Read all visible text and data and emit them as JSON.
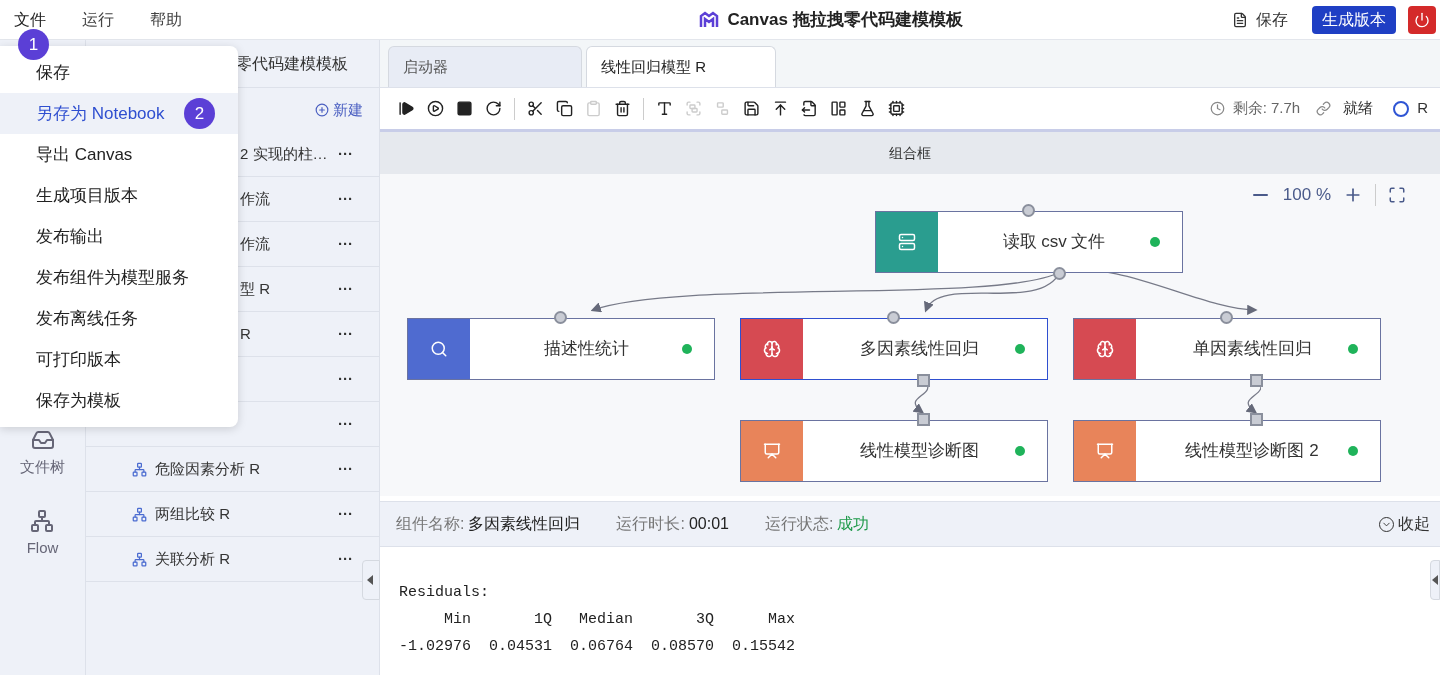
{
  "menubar": [
    {
      "label": "文件",
      "selected": true
    },
    {
      "label": "运行",
      "selected": false
    },
    {
      "label": "帮助",
      "selected": false
    }
  ],
  "app_title": "Canvas 拖拉拽零代码建模模板",
  "header_actions": {
    "save": "保存",
    "publish": "生成版本"
  },
  "file_menu": {
    "badge": "1",
    "items": [
      {
        "label": "保存",
        "selected": false
      },
      {
        "label": "另存为 Notebook",
        "selected": true,
        "badge": "2"
      },
      {
        "label": "导出 Canvas",
        "selected": false
      },
      {
        "label": "生成项目版本",
        "selected": false
      },
      {
        "label": "发布输出",
        "selected": false
      },
      {
        "label": "发布组件为模型服务",
        "selected": false
      },
      {
        "label": "发布离线任务",
        "selected": false
      },
      {
        "label": "可打印版本",
        "selected": false
      },
      {
        "label": "保存为模板",
        "selected": false
      }
    ]
  },
  "rail": [
    {
      "label": "文件树"
    },
    {
      "label": "Flow"
    }
  ],
  "sidebar": {
    "title": "零代码建模模板",
    "new_button": "新建",
    "items": [
      {
        "kind": "partial",
        "text": "2 实现的柱…",
        "more": "···"
      },
      {
        "kind": "partial",
        "text": "作流",
        "more": "···"
      },
      {
        "kind": "partial",
        "text": "作流",
        "more": "···"
      },
      {
        "kind": "partial",
        "text": "型 R",
        "more": "···"
      },
      {
        "kind": "partial",
        "text": "R",
        "more": "···"
      },
      {
        "kind": "hidden",
        "more": "···"
      },
      {
        "kind": "hidden",
        "more": "···"
      },
      {
        "kind": "full",
        "text": "危险因素分析 R",
        "more": "···"
      },
      {
        "kind": "full",
        "text": "两组比较 R",
        "more": "···"
      },
      {
        "kind": "full",
        "text": "关联分析 R",
        "more": "···"
      }
    ]
  },
  "tabs": [
    {
      "label": "启动器",
      "selected": false
    },
    {
      "label": "线性回归模型 R",
      "selected": true
    }
  ],
  "toolbar": [
    {
      "disabled": false
    },
    {
      "disabled": false
    },
    {
      "disabled": false
    },
    {
      "disabled": false
    },
    {
      "disabled": false
    },
    {
      "disabled": false
    },
    {
      "disabled": true
    },
    {
      "disabled": false
    },
    {
      "disabled": false
    },
    {
      "disabled": true
    },
    {
      "disabled": true
    },
    {
      "disabled": false
    },
    {
      "disabled": false
    },
    {
      "disabled": false
    },
    {
      "disabled": false
    },
    {
      "disabled": false
    },
    {
      "disabled": false
    }
  ],
  "kernel": {
    "remaining": "剩余: 7.7h",
    "status": "就绪",
    "language": "R"
  },
  "canvas": {
    "group_title": "组合框",
    "zoom": "100 %",
    "nodes": [
      {
        "label": "读取 csv 文件",
        "kind": "data",
        "color": "#2a9d8f",
        "selected": false
      },
      {
        "label": "描述性统计",
        "kind": "search",
        "color": "#4f6bd0",
        "selected": false
      },
      {
        "label": "多因素线性回归",
        "kind": "model",
        "color": "#d64a52",
        "selected": true
      },
      {
        "label": "单因素线性回归",
        "kind": "model",
        "color": "#d64a52",
        "selected": false
      },
      {
        "label": "线性模型诊断图",
        "kind": "chart",
        "color": "#e8845a",
        "selected": false
      },
      {
        "label": "线性模型诊断图 2",
        "kind": "chart",
        "color": "#e8845a",
        "selected": false
      }
    ]
  },
  "info_bar": {
    "fields": [
      {
        "label": "组件名称:",
        "value": "多因素线性回归",
        "kind": "plain"
      },
      {
        "label": "运行时长:",
        "value": "00:01",
        "kind": "plain"
      },
      {
        "label": "运行状态:",
        "value": "成功",
        "kind": "success"
      }
    ],
    "collapse": "收起"
  },
  "output": [
    "Residuals:",
    "     Min       1Q   Median       3Q      Max",
    "-1.02976  0.04531  0.06764  0.08570  0.15542"
  ]
}
